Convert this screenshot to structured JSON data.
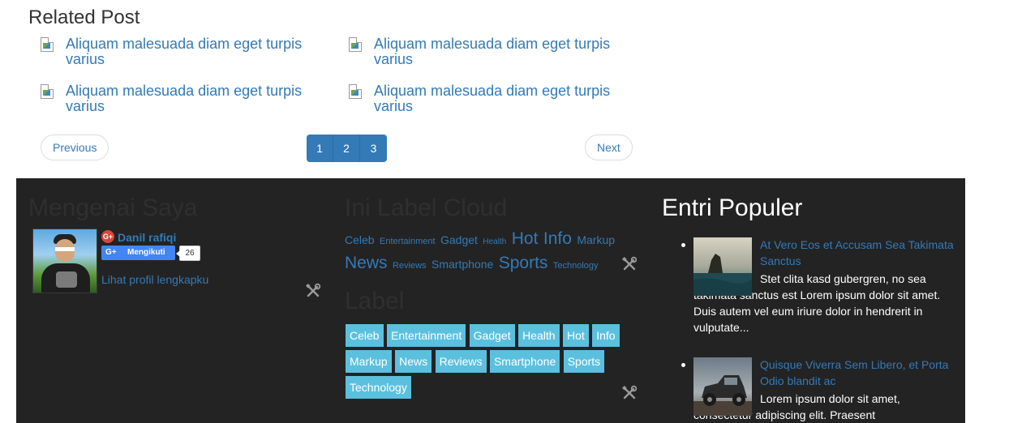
{
  "related": {
    "title": "Related Post",
    "posts": [
      {
        "title": "Aliquam malesuada diam eget turpis varius"
      },
      {
        "title": "Aliquam malesuada diam eget turpis varius"
      },
      {
        "title": "Aliquam malesuada diam eget turpis varius"
      },
      {
        "title": "Aliquam malesuada diam eget turpis varius"
      }
    ],
    "pager": {
      "previous": "Previous",
      "next": "Next",
      "pages": [
        "1",
        "2",
        "3"
      ]
    }
  },
  "about": {
    "title": "Mengenai Saya",
    "name": "Danil rafiqi",
    "follow_label": "Mengikuti",
    "follow_count": "26",
    "profile_link": "Lihat profil lengkapku"
  },
  "label_cloud": {
    "title": "Ini Label Cloud",
    "tags": [
      "Celeb",
      "Entertainment",
      "Gadget",
      "Health",
      "Hot",
      "Info",
      "Markup",
      "News",
      "Reviews",
      "Smartphone",
      "Sports",
      "Technology"
    ]
  },
  "label_list": {
    "title": "Label",
    "labels": [
      "Celeb",
      "Entertainment",
      "Gadget",
      "Health",
      "Hot",
      "Info",
      "Markup",
      "News",
      "Reviews",
      "Smartphone",
      "Sports",
      "Technology"
    ]
  },
  "popular": {
    "title": "Entri Populer",
    "posts": [
      {
        "title": "At Vero Eos et Accusam Sea Takimata Sanctus",
        "excerpt": "Stet clita kasd gubergren, no sea takimata sanctus est Lorem ipsum dolor sit amet. Duis autem vel eum iriure dolor in hendrerit in vulputate..."
      },
      {
        "title": "Quisque Viverra Sem Libero, et Porta Odio blandit ac",
        "excerpt": "Lorem ipsum dolor sit amet, consectetur adipiscing elit. Praesent"
      }
    ]
  },
  "colors": {
    "link": "#337ab7",
    "footer_bg": "#232323",
    "label_chip": "#5bc0de",
    "pagination": "#337ab7"
  }
}
